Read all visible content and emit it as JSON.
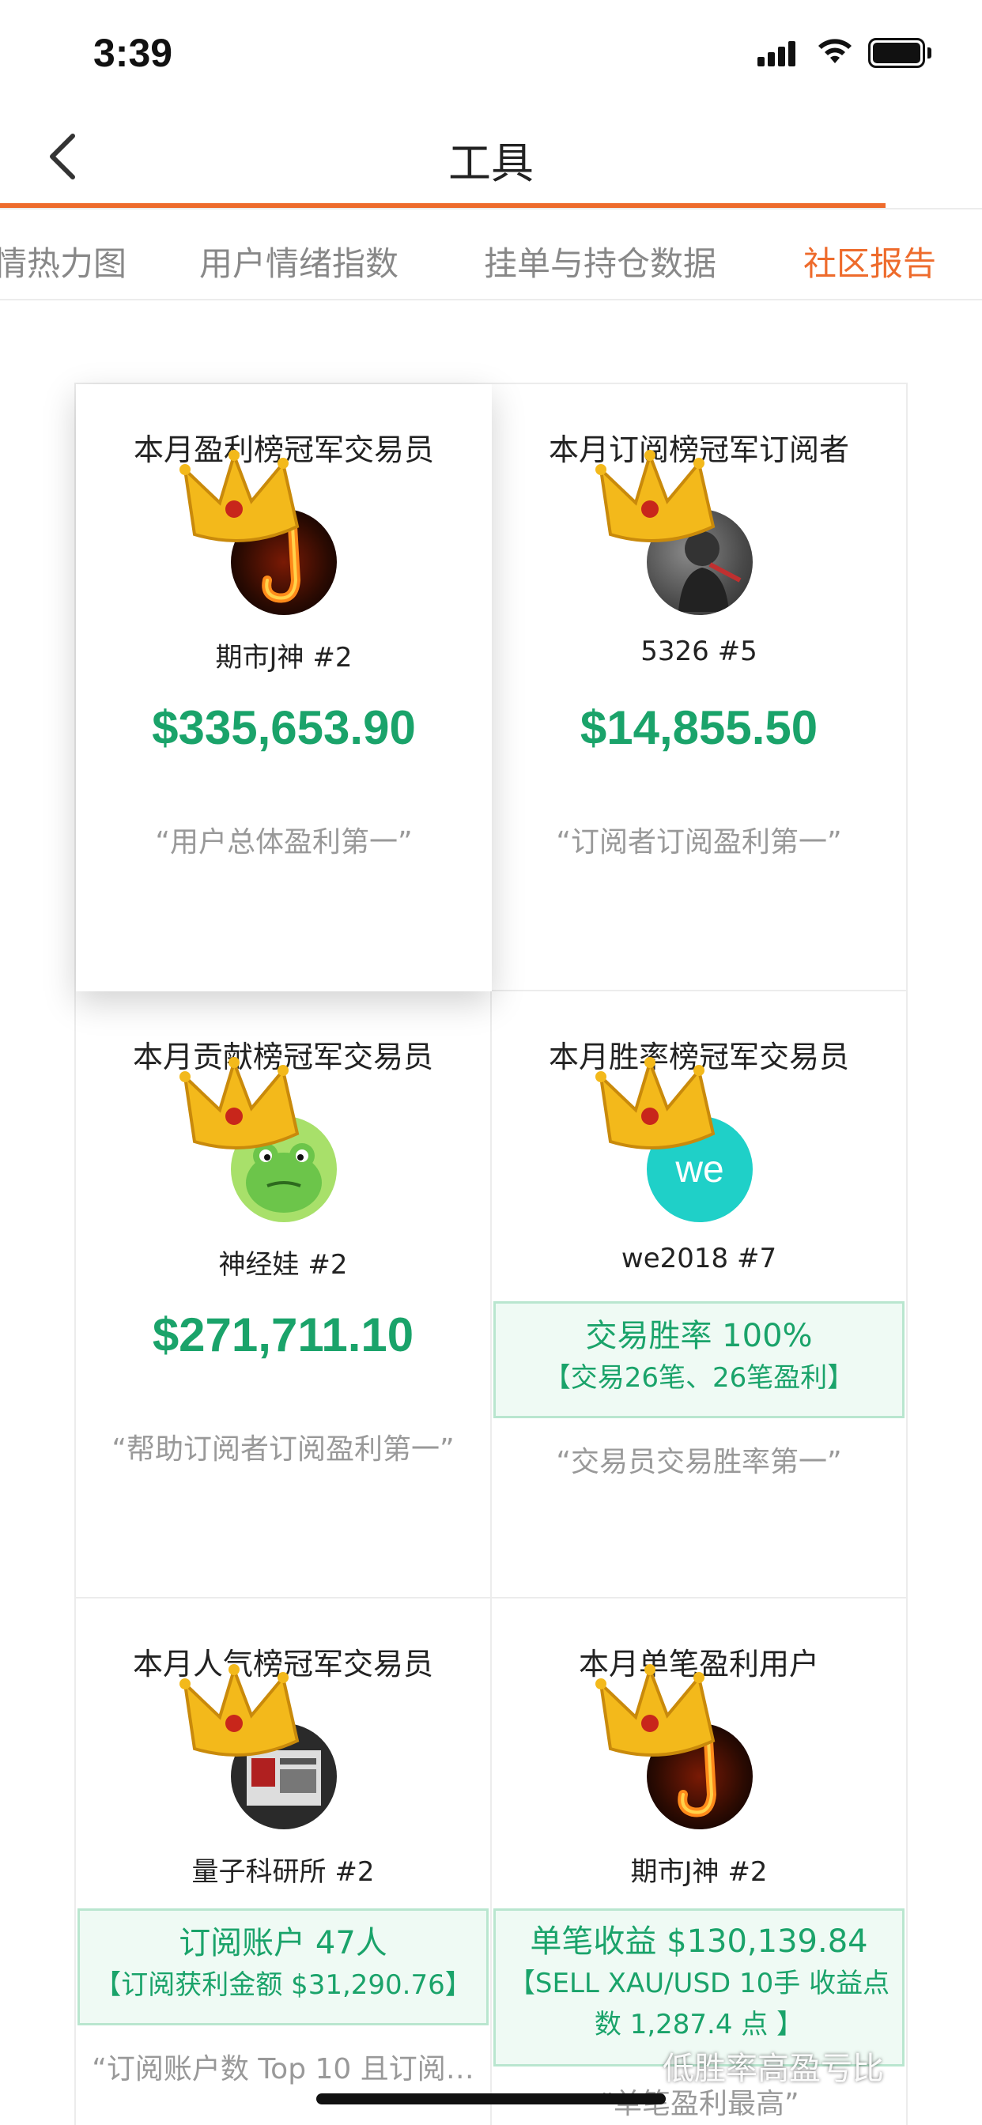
{
  "status_bar": {
    "time": "3:39"
  },
  "nav": {
    "title": "工具"
  },
  "tabs": [
    {
      "label": "情热力图",
      "active": false
    },
    {
      "label": "用户情绪指数",
      "active": false
    },
    {
      "label": "挂单与持仓数据",
      "active": false
    },
    {
      "label": "社区报告",
      "active": true
    }
  ],
  "cards": [
    {
      "title": "本月盈利榜冠军交易员",
      "name": "期市J神 #2",
      "amount": "$335,653.90",
      "quote": "“用户总体盈利第一”",
      "avatar_icon": "fire-j-avatar"
    },
    {
      "title": "本月订阅榜冠军订阅者",
      "name": "5326 #5",
      "amount": "$14,855.50",
      "quote": "“订阅者订阅盈利第一”",
      "avatar_icon": "rider-avatar"
    },
    {
      "title": "本月贡献榜冠军交易员",
      "name": "神经娃 #2",
      "amount": "$271,711.10",
      "quote": "“帮助订阅者订阅盈利第一”",
      "avatar_icon": "frog-avatar"
    },
    {
      "title": "本月胜率榜冠军交易员",
      "name": "we2018 #7",
      "avatar_text": "we",
      "stat_main": "交易胜率 100%",
      "stat_sub": "【交易26笔、26笔盈利】",
      "quote": "“交易员交易胜率第一”",
      "avatar_icon": "we-avatar"
    },
    {
      "title": "本月人气榜冠军交易员",
      "name": "量子科研所 #2",
      "stat_main": "订阅账户 47人",
      "stat_sub": "【订阅获利金额 $31,290.76】",
      "quote": "“订阅账户数 Top 10 且订阅…",
      "avatar_icon": "usa-avatar"
    },
    {
      "title": "本月单笔盈利用户",
      "name": "期市J神 #2",
      "stat_main": "单笔收益 $130,139.84",
      "stat_sub": "【SELL XAU/USD 10手 收益点",
      "stat_sub2": "数 1,287.4 点 】",
      "quote": "“单笔盈利最高”",
      "avatar_icon": "fire-j-avatar"
    }
  ],
  "watermark": "低胜率高盈亏比",
  "colors": {
    "accent": "#ee6b2c",
    "green": "#1aa36a",
    "stat_bg": "#effaf4"
  }
}
